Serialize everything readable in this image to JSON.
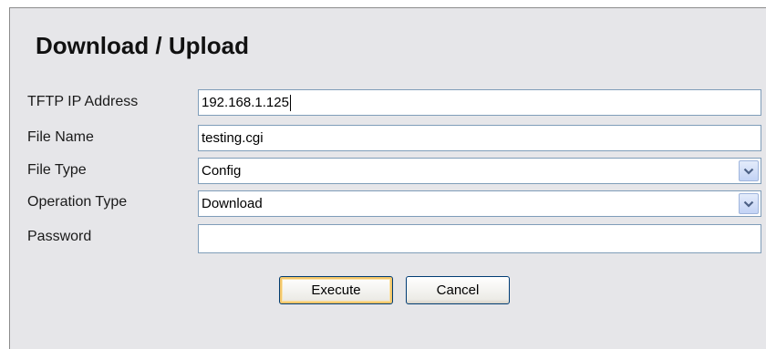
{
  "form": {
    "title": "Download / Upload",
    "fields": [
      {
        "label": "TFTP IP Address",
        "value": "192.168.1.125"
      },
      {
        "label": "File Name",
        "value": "testing.cgi"
      },
      {
        "label": "File Type",
        "value": "Config"
      },
      {
        "label": "Operation Type",
        "value": "Download"
      },
      {
        "label": "Password",
        "value": ""
      }
    ],
    "buttons": {
      "execute_label": "Execute",
      "cancel_label": "Cancel"
    }
  },
  "icons": {
    "dropdown": "chevron-down-icon"
  }
}
